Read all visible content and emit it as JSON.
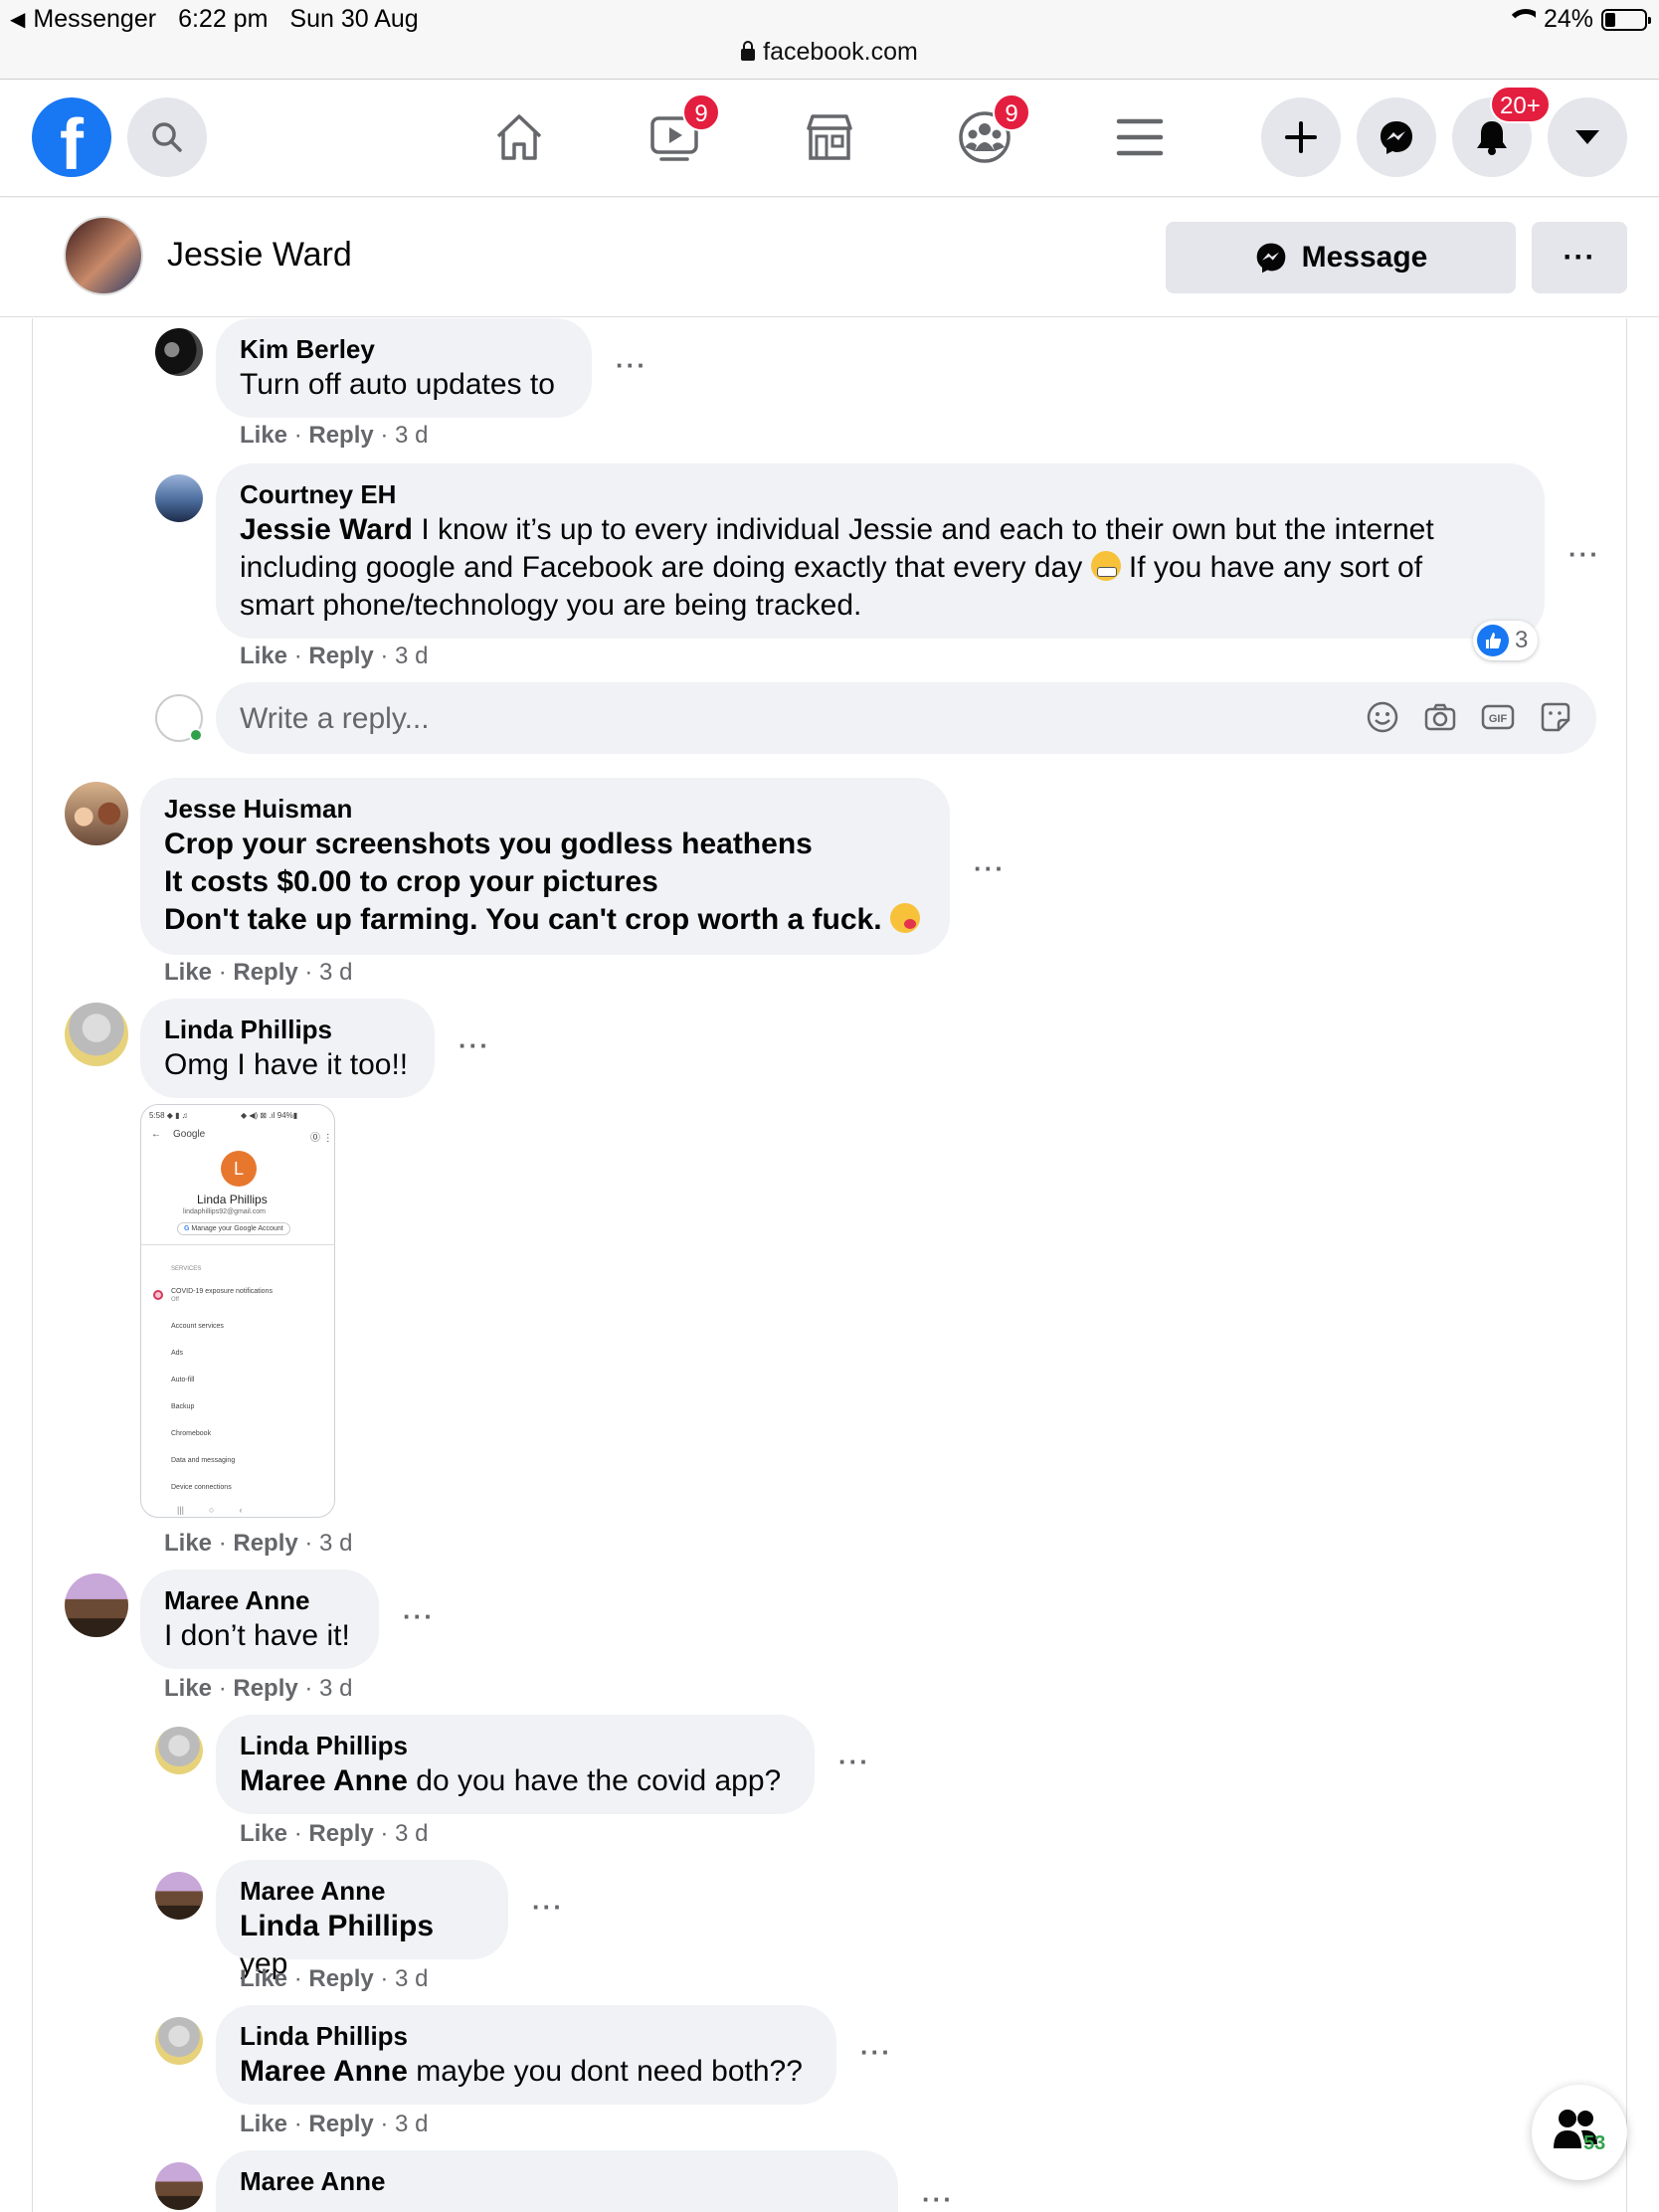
{
  "status_bar": {
    "back_app": "Messenger",
    "time": "6:22 pm",
    "date": "Sun 30 Aug",
    "battery": "24%",
    "url": "facebook.com"
  },
  "navbar": {
    "watch_badge": "9",
    "groups_badge": "9",
    "notifications_badge": "20+"
  },
  "profile": {
    "name": "Jessie Ward",
    "message_label": "Message",
    "more_label": "···"
  },
  "comments": [
    {
      "name": "Kim Berley",
      "text": "Turn off auto updates to",
      "like": "Like",
      "reply": "Reply",
      "time": "3 d"
    },
    {
      "name": "Courtney EH",
      "mention": "Jessie Ward",
      "text_line1": " I know it’s up to every individual Jessie and each to their own but the internet",
      "text_line2a": "including google and Facebook are doing exactly that every day ",
      "text_line2b": " If you have any sort of",
      "text_line3": "smart phone/technology you are being tracked.",
      "reactions": "3",
      "like": "Like",
      "reply": "Reply",
      "time": "3 d"
    },
    {
      "name": "Jesse Huisman",
      "line1": "Crop your screenshots you godless heathens",
      "line2": "It costs $0.00 to crop your pictures",
      "line3": "Don't take up farming. You can't crop worth a fuck. ",
      "like": "Like",
      "reply": "Reply",
      "time": "3 d"
    },
    {
      "name": "Linda Phillips",
      "text": "Omg I have it too!!",
      "like": "Like",
      "reply": "Reply",
      "time": "3 d"
    },
    {
      "name": "Maree Anne",
      "text": "I don’t have it!",
      "like": "Like",
      "reply": "Reply",
      "time": "3 d"
    },
    {
      "name": "Linda Phillips",
      "mention": "Maree Anne",
      "text": " do you have the covid app?",
      "like": "Like",
      "reply": "Reply",
      "time": "3 d"
    },
    {
      "name": "Maree Anne",
      "mention": "Linda Phillips",
      "text": " yep",
      "like": "Like",
      "reply": "Reply",
      "time": "3 d"
    },
    {
      "name": "Linda Phillips",
      "mention": "Maree Anne",
      "text": " maybe you dont need both??",
      "like": "Like",
      "reply": "Reply",
      "time": "3 d"
    },
    {
      "name": "Maree Anne"
    }
  ],
  "reply_box": {
    "placeholder": "Write a reply..."
  },
  "attached_screenshot": {
    "status": "5:58 ◆ ▮ ♫",
    "status_right": "◆ ◀) ⊠ .ıl 94%▮",
    "app": "Google",
    "initial": "L",
    "name": "Linda Phillips",
    "email": "lindaphillips92@gmail.com",
    "manage": "Manage your Google Account",
    "section": "SERVICES",
    "items": [
      "COVID-19 exposure notifications",
      "Account services",
      "Ads",
      "Auto-fill",
      "Backup",
      "Chromebook",
      "Data and messaging",
      "Device connections"
    ],
    "covid_sub": "Off"
  },
  "people_fab": {
    "count": "53"
  },
  "colors": {
    "fb_blue": "#1877f2",
    "badge_red": "#e41e3f",
    "bubble_bg": "#f0f2f5",
    "meta_gray": "#65676b"
  }
}
